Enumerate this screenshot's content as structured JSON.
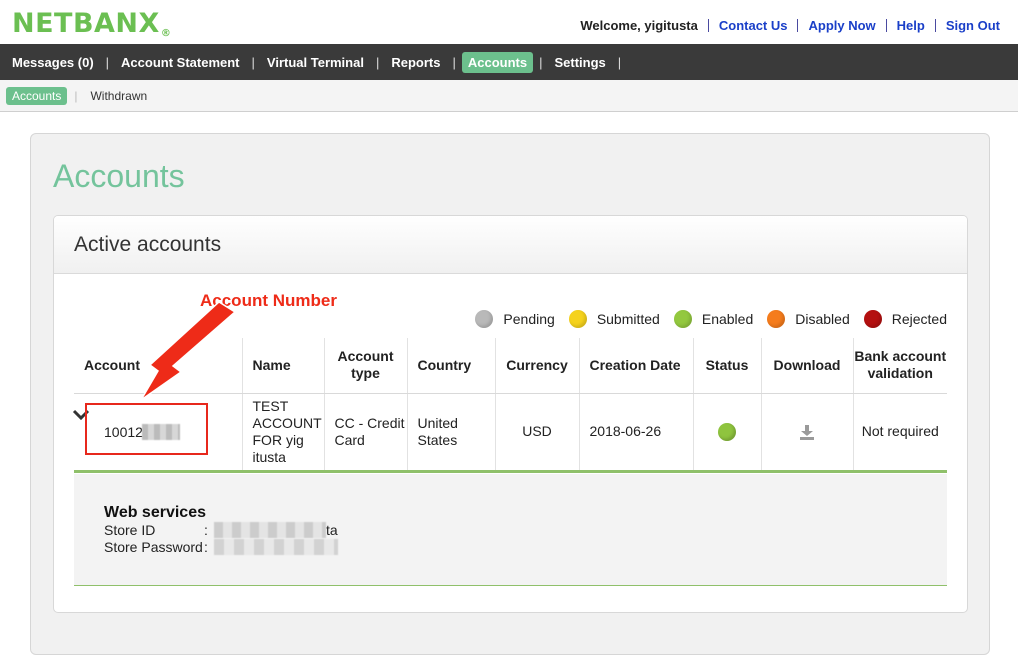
{
  "header": {
    "logo": "NETBANX",
    "logo_mark": "®",
    "welcome": "Welcome, yigitusta",
    "links": [
      "Contact Us",
      "Apply Now",
      "Help",
      "Sign Out"
    ]
  },
  "nav": {
    "items": [
      "Messages (0)",
      "Account Statement",
      "Virtual Terminal",
      "Reports",
      "Accounts",
      "Settings"
    ],
    "active": "Accounts"
  },
  "subnav": {
    "items": [
      "Accounts",
      "Withdrawn"
    ],
    "active": "Accounts"
  },
  "page": {
    "title": "Accounts",
    "panel_title": "Active accounts"
  },
  "annotation": {
    "label": "Account Number",
    "color": "#ee2b18"
  },
  "legend": [
    {
      "label": "Pending",
      "color": "#b9b9b9"
    },
    {
      "label": "Submitted",
      "color": "#f5d21d"
    },
    {
      "label": "Enabled",
      "color": "#93c83f"
    },
    {
      "label": "Disabled",
      "color": "#f57c1c"
    },
    {
      "label": "Rejected",
      "color": "#b41010"
    }
  ],
  "table": {
    "headers": [
      "Account",
      "Name",
      "Account type",
      "Country",
      "Currency",
      "Creation Date",
      "Status",
      "Download",
      "Bank account validation"
    ],
    "rows": [
      {
        "account": "10012",
        "name": "TEST ACCOUNT FOR yig itusta",
        "type": "CC - Credit Card",
        "country": "United States",
        "currency": "USD",
        "created": "2018-06-26",
        "status": "Enabled",
        "download_icon": "download-icon",
        "validation": "Not required"
      }
    ]
  },
  "web_services": {
    "title": "Web services",
    "store_id_label": "Store ID",
    "store_id_suffix": "ta",
    "store_password_label": "Store Password",
    "colon": ":"
  },
  "colors": {
    "brand_green": "#6bbf52",
    "accent_teal": "#6cc08d",
    "nav_bg": "#3a3a3a",
    "link_blue": "#1a3fc8"
  }
}
